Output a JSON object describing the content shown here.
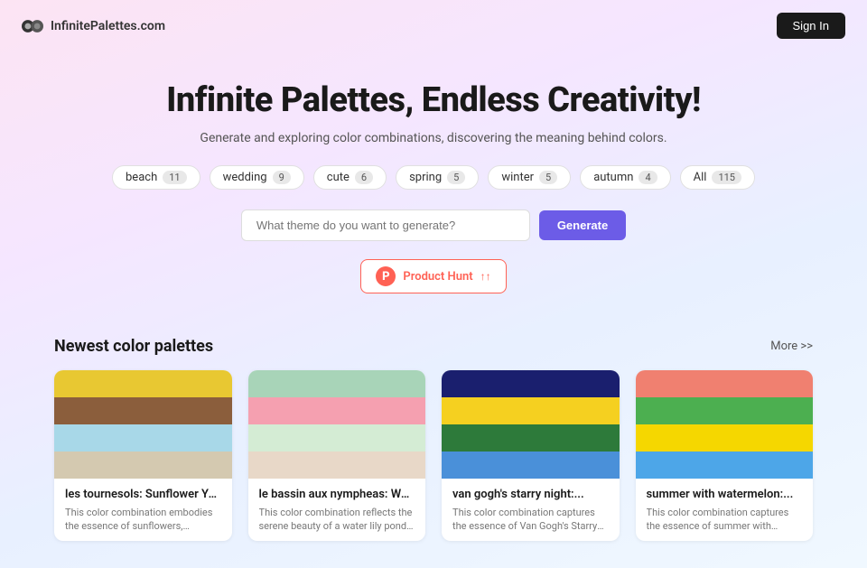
{
  "header": {
    "logo_text": "InfinitePalettes.com",
    "sign_in_label": "Sign In"
  },
  "hero": {
    "title": "Infinite Palettes, Endless Creativity!",
    "subtitle": "Generate and exploring color combinations, discovering the meaning behind colors.",
    "search_placeholder": "What theme do you want to generate?",
    "generate_label": "Generate"
  },
  "tags": [
    {
      "label": "beach",
      "count": "11"
    },
    {
      "label": "wedding",
      "count": "9"
    },
    {
      "label": "cute",
      "count": "6"
    },
    {
      "label": "spring",
      "count": "5"
    },
    {
      "label": "winter",
      "count": "5"
    },
    {
      "label": "autumn",
      "count": "4"
    },
    {
      "label": "All",
      "count": "115"
    }
  ],
  "product_hunt": {
    "icon_letter": "P",
    "text": "Product Hunt",
    "arrow": "↑↑"
  },
  "palettes_section": {
    "title": "Newest color palettes",
    "more_label": "More >>",
    "palettes": [
      {
        "name": "les tournesols: Sunflower Yello...",
        "description": "This color combination embodies the essence of sunflowers, representing joy, stability, and a connection to nature. Th...",
        "swatches": [
          "#e8c832",
          "#8b5e3c",
          "#a8d8e8",
          "#d4c9b0"
        ]
      },
      {
        "name": "le bassin aux nympheas: Water...",
        "description": "This color combination reflects the serene beauty of a water lily pond, combining the tranquility of nature with...",
        "swatches": [
          "#a8d4b8",
          "#f5a0b0",
          "#d4ecd4",
          "#e8d8c8"
        ]
      },
      {
        "name": "van gogh's starry night:...",
        "description": "This color combination captures the essence of Van Gogh's Starry Night, blending the calmness of the night sky...",
        "swatches": [
          "#1a1f6e",
          "#f5d020",
          "#2d7a3a",
          "#4a90d9"
        ]
      },
      {
        "name": "summer with watermelon:...",
        "description": "This color combination captures the essence of summer with watermelon, blending vibrant and refreshing hues th...",
        "swatches": [
          "#f08070",
          "#4caf50",
          "#f5d700",
          "#4da6e8"
        ]
      }
    ]
  }
}
